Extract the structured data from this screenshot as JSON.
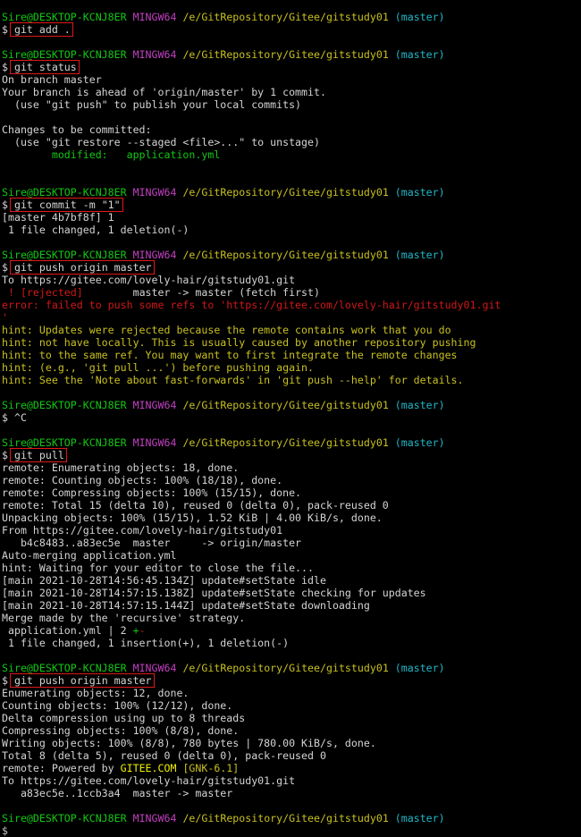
{
  "terminal": {
    "lines": [
      {
        "segments": [
          {
            "t": "Sire@DESKTOP-KCNJ8ER",
            "c": "green"
          },
          {
            "t": " ",
            "c": "white"
          },
          {
            "t": "MINGW64",
            "c": "magenta"
          },
          {
            "t": " ",
            "c": "white"
          },
          {
            "t": "/e/GitRepository/Gitee/gitstudy01",
            "c": "yellow"
          },
          {
            "t": " ",
            "c": "white"
          },
          {
            "t": "(master)",
            "c": "cyan"
          }
        ]
      },
      {
        "segments": [
          {
            "t": "$ ",
            "c": "white"
          },
          {
            "t": "git add .",
            "c": "white"
          }
        ],
        "cmd": true
      },
      {
        "segments": []
      },
      {
        "segments": [
          {
            "t": "Sire@DESKTOP-KCNJ8ER",
            "c": "green"
          },
          {
            "t": " ",
            "c": "white"
          },
          {
            "t": "MINGW64",
            "c": "magenta"
          },
          {
            "t": " ",
            "c": "white"
          },
          {
            "t": "/e/GitRepository/Gitee/gitstudy01",
            "c": "yellow"
          },
          {
            "t": " ",
            "c": "white"
          },
          {
            "t": "(master)",
            "c": "cyan"
          }
        ]
      },
      {
        "segments": [
          {
            "t": "$ ",
            "c": "white"
          },
          {
            "t": "git status",
            "c": "white"
          }
        ],
        "cmd": true
      },
      {
        "segments": [
          {
            "t": "On branch master",
            "c": "white"
          }
        ]
      },
      {
        "segments": [
          {
            "t": "Your branch is ahead of 'origin/master' by 1 commit.",
            "c": "white"
          }
        ]
      },
      {
        "segments": [
          {
            "t": "  (use \"git push\" to publish your local commits)",
            "c": "white"
          }
        ]
      },
      {
        "segments": []
      },
      {
        "segments": [
          {
            "t": "Changes to be committed:",
            "c": "white"
          }
        ]
      },
      {
        "segments": [
          {
            "t": "  (use \"git restore --staged <file>...\" to unstage)",
            "c": "white"
          }
        ]
      },
      {
        "segments": [
          {
            "t": "        modified:   application.yml",
            "c": "green"
          }
        ]
      },
      {
        "segments": []
      },
      {
        "segments": []
      },
      {
        "segments": [
          {
            "t": "Sire@DESKTOP-KCNJ8ER",
            "c": "green"
          },
          {
            "t": " ",
            "c": "white"
          },
          {
            "t": "MINGW64",
            "c": "magenta"
          },
          {
            "t": " ",
            "c": "white"
          },
          {
            "t": "/e/GitRepository/Gitee/gitstudy01",
            "c": "yellow"
          },
          {
            "t": " ",
            "c": "white"
          },
          {
            "t": "(master)",
            "c": "cyan"
          }
        ]
      },
      {
        "segments": [
          {
            "t": "$ ",
            "c": "white"
          },
          {
            "t": "git commit -m \"1\"",
            "c": "white"
          }
        ],
        "cmd": true
      },
      {
        "segments": [
          {
            "t": "[master 4b7bf8f] 1",
            "c": "white"
          }
        ]
      },
      {
        "segments": [
          {
            "t": " 1 file changed, 1 deletion(-)",
            "c": "white"
          }
        ]
      },
      {
        "segments": []
      },
      {
        "segments": [
          {
            "t": "Sire@DESKTOP-KCNJ8ER",
            "c": "green"
          },
          {
            "t": " ",
            "c": "white"
          },
          {
            "t": "MINGW64",
            "c": "magenta"
          },
          {
            "t": " ",
            "c": "white"
          },
          {
            "t": "/e/GitRepository/Gitee/gitstudy01",
            "c": "yellow"
          },
          {
            "t": " ",
            "c": "white"
          },
          {
            "t": "(master)",
            "c": "cyan"
          }
        ]
      },
      {
        "segments": [
          {
            "t": "$ ",
            "c": "white"
          },
          {
            "t": "git push origin master",
            "c": "white"
          }
        ],
        "cmd": true
      },
      {
        "segments": [
          {
            "t": "To https://gitee.com/lovely-hair/gitstudy01.git",
            "c": "white"
          }
        ]
      },
      {
        "segments": [
          {
            "t": " ! [rejected]",
            "c": "red"
          },
          {
            "t": "        master -> master (fetch first)",
            "c": "white"
          }
        ]
      },
      {
        "segments": [
          {
            "t": "error: failed to push some refs to 'https://gitee.com/lovely-hair/gitstudy01.git",
            "c": "red"
          }
        ]
      },
      {
        "segments": [
          {
            "t": "'",
            "c": "red"
          }
        ]
      },
      {
        "segments": [
          {
            "t": "hint: Updates were rejected because the remote contains work that you do",
            "c": "yellow"
          }
        ]
      },
      {
        "segments": [
          {
            "t": "hint: not have locally. This is usually caused by another repository pushing",
            "c": "yellow"
          }
        ]
      },
      {
        "segments": [
          {
            "t": "hint: to the same ref. You may want to first integrate the remote changes",
            "c": "yellow"
          }
        ]
      },
      {
        "segments": [
          {
            "t": "hint: (e.g., 'git pull ...') before pushing again.",
            "c": "yellow"
          }
        ]
      },
      {
        "segments": [
          {
            "t": "hint: See the 'Note about fast-forwards' in 'git push --help' for details.",
            "c": "yellow"
          }
        ]
      },
      {
        "segments": []
      },
      {
        "segments": [
          {
            "t": "Sire@DESKTOP-KCNJ8ER",
            "c": "green"
          },
          {
            "t": " ",
            "c": "white"
          },
          {
            "t": "MINGW64",
            "c": "magenta"
          },
          {
            "t": " ",
            "c": "white"
          },
          {
            "t": "/e/GitRepository/Gitee/gitstudy01",
            "c": "yellow"
          },
          {
            "t": " ",
            "c": "white"
          },
          {
            "t": "(master)",
            "c": "cyan"
          }
        ]
      },
      {
        "segments": [
          {
            "t": "$ ",
            "c": "white"
          },
          {
            "t": "^C",
            "c": "white"
          }
        ]
      },
      {
        "segments": []
      },
      {
        "segments": [
          {
            "t": "Sire@DESKTOP-KCNJ8ER",
            "c": "green"
          },
          {
            "t": " ",
            "c": "white"
          },
          {
            "t": "MINGW64",
            "c": "magenta"
          },
          {
            "t": " ",
            "c": "white"
          },
          {
            "t": "/e/GitRepository/Gitee/gitstudy01",
            "c": "yellow"
          },
          {
            "t": " ",
            "c": "white"
          },
          {
            "t": "(master)",
            "c": "cyan"
          }
        ]
      },
      {
        "segments": [
          {
            "t": "$ ",
            "c": "white"
          },
          {
            "t": "git pull",
            "c": "white"
          }
        ],
        "cmd": true
      },
      {
        "segments": [
          {
            "t": "remote: Enumerating objects: 18, done.",
            "c": "white"
          }
        ]
      },
      {
        "segments": [
          {
            "t": "remote: Counting objects: 100% (18/18), done.",
            "c": "white"
          }
        ]
      },
      {
        "segments": [
          {
            "t": "remote: Compressing objects: 100% (15/15), done.",
            "c": "white"
          }
        ]
      },
      {
        "segments": [
          {
            "t": "remote: Total 15 (delta 10), reused 0 (delta 0), pack-reused 0",
            "c": "white"
          }
        ]
      },
      {
        "segments": [
          {
            "t": "Unpacking objects: 100% (15/15), 1.52 KiB | 4.00 KiB/s, done.",
            "c": "white"
          }
        ]
      },
      {
        "segments": [
          {
            "t": "From https://gitee.com/lovely-hair/gitstudy01",
            "c": "white"
          }
        ]
      },
      {
        "segments": [
          {
            "t": "   b4c8483..a83ec5e  master     -> origin/master",
            "c": "white"
          }
        ]
      },
      {
        "segments": [
          {
            "t": "Auto-merging application.yml",
            "c": "white"
          }
        ]
      },
      {
        "segments": [
          {
            "t": "hint: Waiting for your editor to close the file...",
            "c": "white"
          }
        ]
      },
      {
        "segments": [
          {
            "t": "[main 2021-10-28T14:56:45.134Z] update#setState idle",
            "c": "white"
          }
        ]
      },
      {
        "segments": [
          {
            "t": "[main 2021-10-28T14:57:15.138Z] update#setState checking for updates",
            "c": "white"
          }
        ]
      },
      {
        "segments": [
          {
            "t": "[main 2021-10-28T14:57:15.144Z] update#setState downloading",
            "c": "white"
          }
        ]
      },
      {
        "segments": [
          {
            "t": "Merge made by the 'recursive' strategy.",
            "c": "white"
          }
        ]
      },
      {
        "segments": [
          {
            "t": " application.yml | 2 ",
            "c": "white"
          },
          {
            "t": "+",
            "c": "green"
          },
          {
            "t": "-",
            "c": "red"
          }
        ]
      },
      {
        "segments": [
          {
            "t": " 1 file changed, 1 insertion(+), 1 deletion(-)",
            "c": "white"
          }
        ]
      },
      {
        "segments": []
      },
      {
        "segments": [
          {
            "t": "Sire@DESKTOP-KCNJ8ER",
            "c": "green"
          },
          {
            "t": " ",
            "c": "white"
          },
          {
            "t": "MINGW64",
            "c": "magenta"
          },
          {
            "t": " ",
            "c": "white"
          },
          {
            "t": "/e/GitRepository/Gitee/gitstudy01",
            "c": "yellow"
          },
          {
            "t": " ",
            "c": "white"
          },
          {
            "t": "(master)",
            "c": "cyan"
          }
        ]
      },
      {
        "segments": [
          {
            "t": "$ ",
            "c": "white"
          },
          {
            "t": "git push origin master",
            "c": "white"
          }
        ],
        "cmd": true
      },
      {
        "segments": [
          {
            "t": "Enumerating objects: 12, done.",
            "c": "white"
          }
        ]
      },
      {
        "segments": [
          {
            "t": "Counting objects: 100% (12/12), done.",
            "c": "white"
          }
        ]
      },
      {
        "segments": [
          {
            "t": "Delta compression using up to 8 threads",
            "c": "white"
          }
        ]
      },
      {
        "segments": [
          {
            "t": "Compressing objects: 100% (8/8), done.",
            "c": "white"
          }
        ]
      },
      {
        "segments": [
          {
            "t": "Writing objects: 100% (8/8), 780 bytes | 780.00 KiB/s, done.",
            "c": "white"
          }
        ]
      },
      {
        "segments": [
          {
            "t": "Total 8 (delta 5), reused 0 (delta 0), pack-reused 0",
            "c": "white"
          }
        ]
      },
      {
        "segments": [
          {
            "t": "remote: Powered by ",
            "c": "white"
          },
          {
            "t": "GITEE.COM",
            "c": "brightyellow"
          },
          {
            "t": " ",
            "c": "white"
          },
          {
            "t": "[GNK-6.1]",
            "c": "yellow"
          }
        ]
      },
      {
        "segments": [
          {
            "t": "To https://gitee.com/lovely-hair/gitstudy01.git",
            "c": "white"
          }
        ]
      },
      {
        "segments": [
          {
            "t": "   a83ec5e..1ccb3a4  master -> master",
            "c": "white"
          }
        ]
      },
      {
        "segments": []
      },
      {
        "segments": [
          {
            "t": "Sire@DESKTOP-KCNJ8ER",
            "c": "green"
          },
          {
            "t": " ",
            "c": "white"
          },
          {
            "t": "MINGW64",
            "c": "magenta"
          },
          {
            "t": " ",
            "c": "white"
          },
          {
            "t": "/e/GitRepository/Gitee/gitstudy01",
            "c": "yellow"
          },
          {
            "t": " ",
            "c": "white"
          },
          {
            "t": "(master)",
            "c": "cyan"
          }
        ]
      }
    ],
    "cursor": "$"
  }
}
